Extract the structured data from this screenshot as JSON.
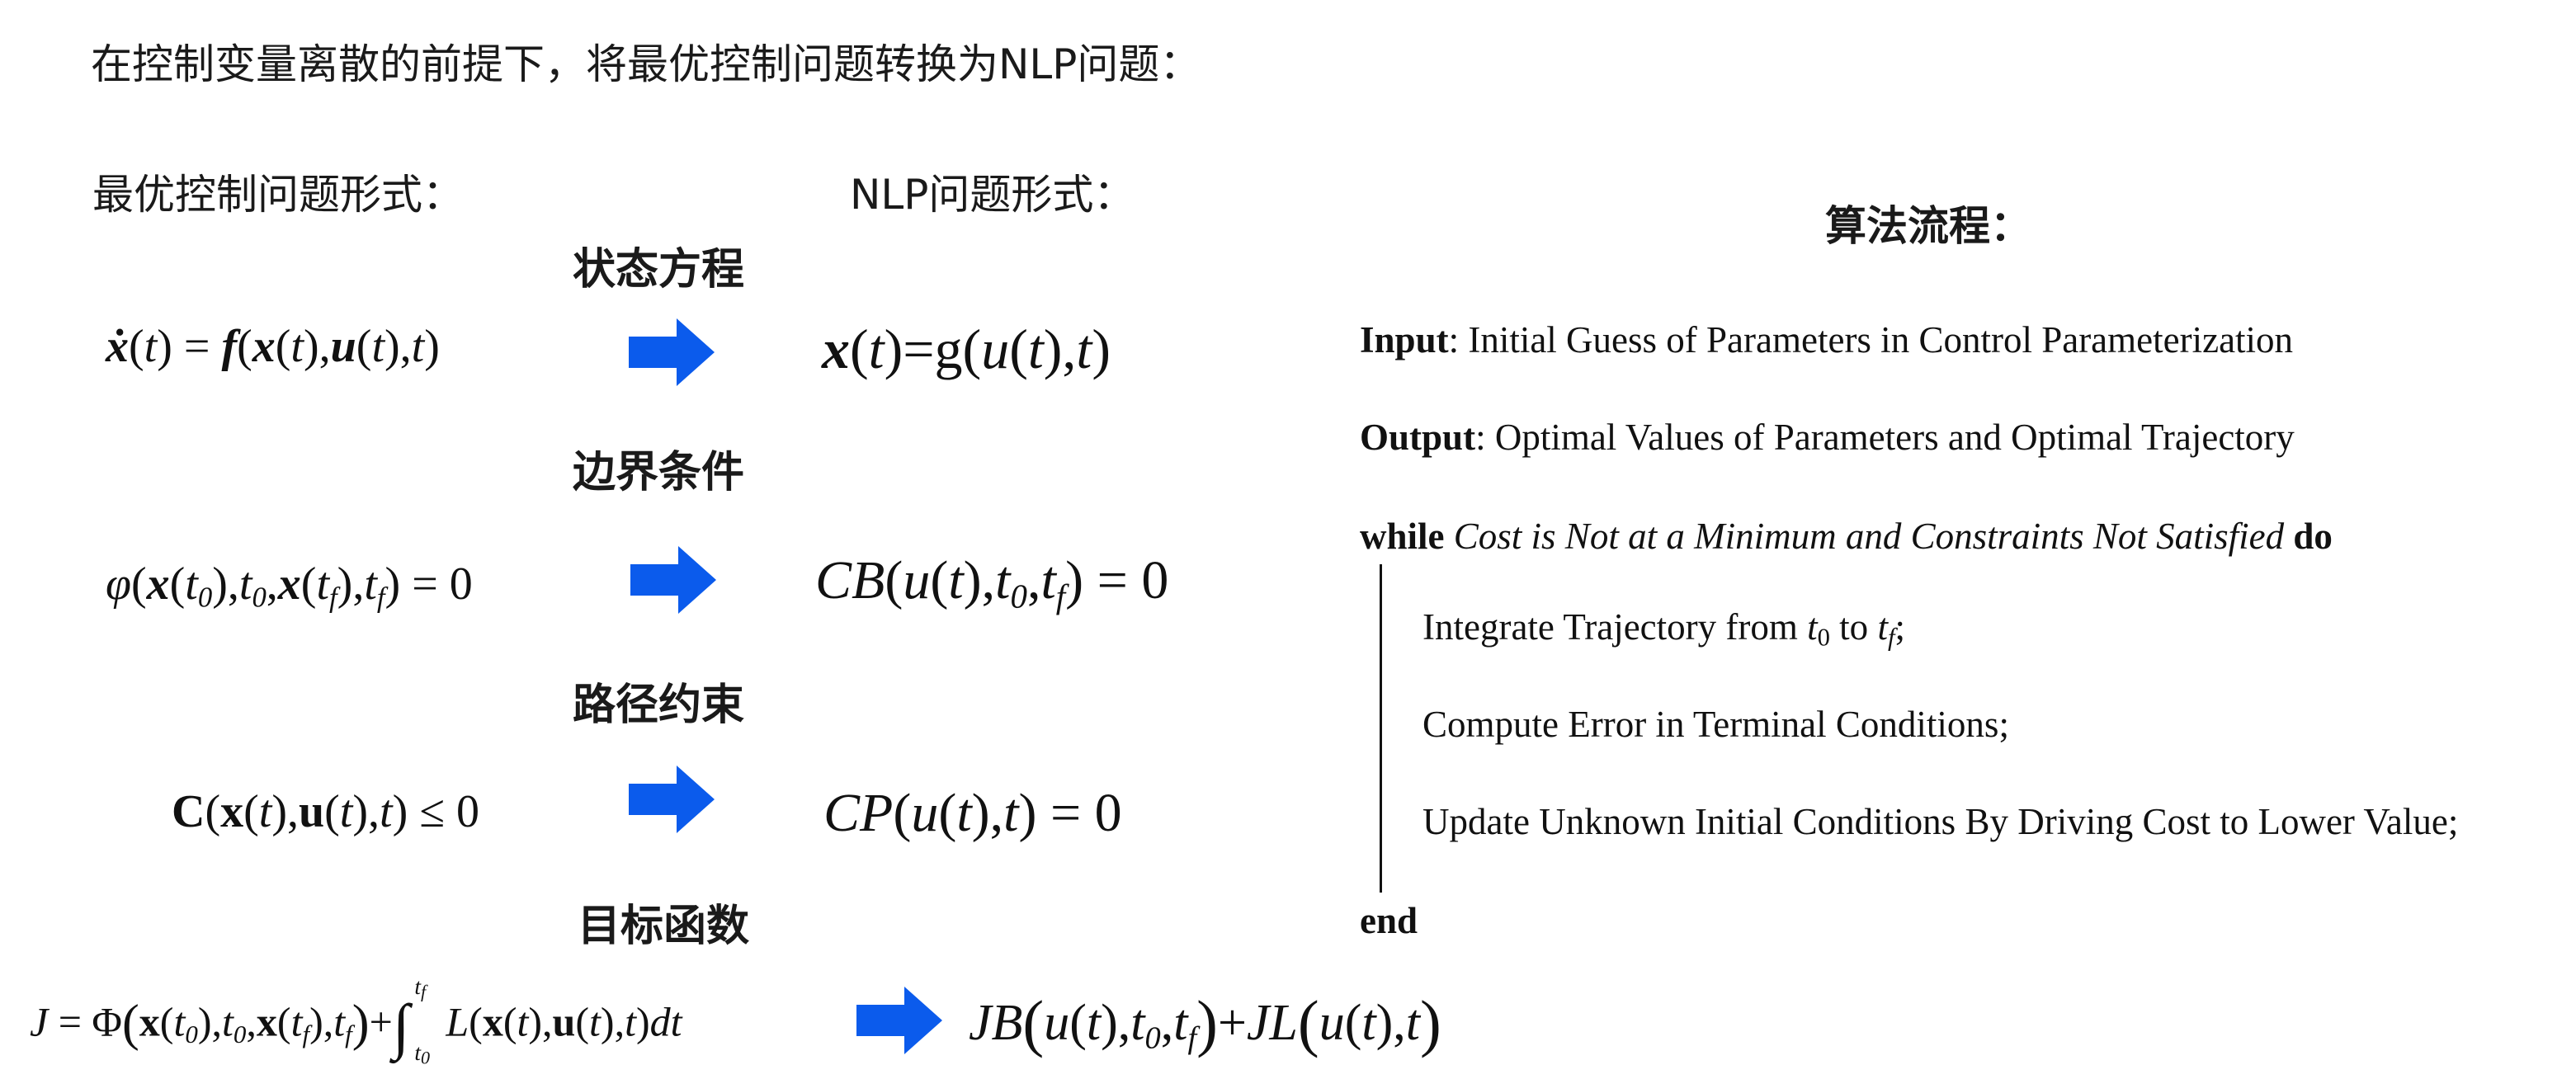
{
  "title": "在控制变量离散的前提下，将最优控制问题转换为NLP问题：",
  "headers": {
    "ocp": "最优控制问题形式：",
    "nlp": "NLP问题形式：",
    "algorithm": "算法流程："
  },
  "sections": {
    "state": "状态方程",
    "boundary": "边界条件",
    "path": "路径约束",
    "objective": "目标函数"
  },
  "colors": {
    "arrow": "#0b5bec",
    "text": "#1a1a1a"
  },
  "algorithm": {
    "input_kw": "Input",
    "input_text": ": Initial Guess of Parameters in Control Parameterization",
    "output_kw": "Output",
    "output_text": ": Optimal Values of Parameters and Optimal Trajectory",
    "while_kw": "while",
    "while_cond": " Cost is Not at a Minimum and Constraints Not Satisfied ",
    "do_kw": "do",
    "step1_text": "Integrate Trajectory from ",
    "step1_t0": "t",
    "step1_t0_sub": "0",
    "step1_to": " to ",
    "step1_tf": "t",
    "step1_tf_sub": "f",
    "step1_end": ";",
    "step2": "Compute Error in Terminal Conditions;",
    "step3": "Update Unknown Initial Conditions By Driving Cost to Lower Value;",
    "end_kw": "end"
  }
}
